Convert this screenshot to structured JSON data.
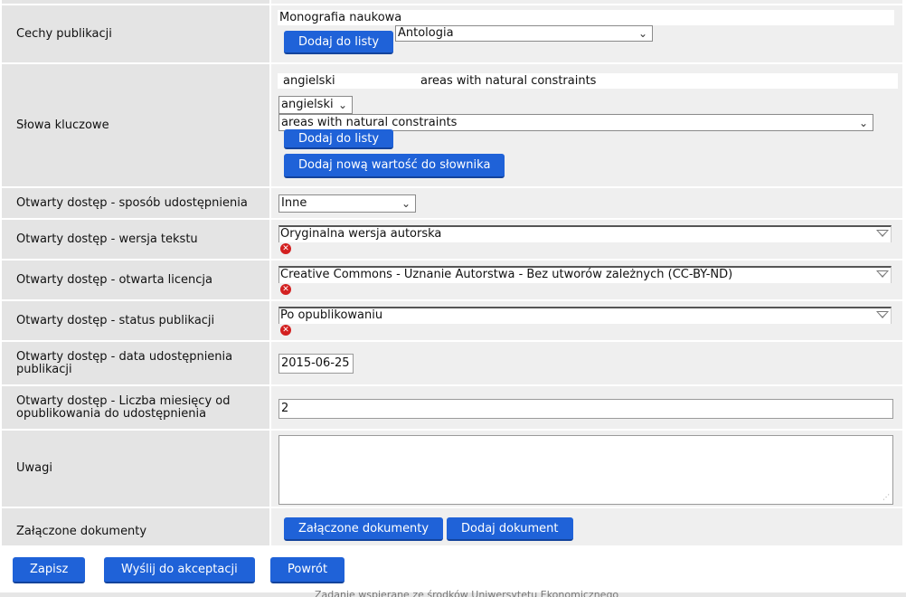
{
  "rows": {
    "cechy": {
      "label": "Cechy publikacji",
      "value": "Monografia naukowa",
      "select_value": "Antologia",
      "button": "Dodaj do listy"
    },
    "slowa": {
      "label": "Słowa kluczowe",
      "entry_lang": "angielski",
      "entry_text": "areas with natural constraints",
      "lang_select": "angielski",
      "keyword_select": "areas with natural constraints",
      "button_add": "Dodaj do listy",
      "button_new": "Dodaj nową wartość do słownika"
    },
    "sposob": {
      "label": "Otwarty dostęp - sposób udostępnienia",
      "select_value": "Inne"
    },
    "wersja": {
      "label": "Otwarty dostęp - wersja tekstu",
      "value": "Oryginalna wersja autorska"
    },
    "licencja": {
      "label": "Otwarty dostęp - otwarta licencja",
      "value": "Creative Commons - Uznanie Autorstwa - Bez utworów zależnych (CC-BY-ND)"
    },
    "status": {
      "label": "Otwarty dostęp - status publikacji",
      "value": "Po opublikowaniu"
    },
    "data": {
      "label": "Otwarty dostęp - data udostępnienia publikacji",
      "value": "2015-06-25"
    },
    "miesiace": {
      "label": "Otwarty dostęp - Liczba miesięcy od opublikowania do udostępnienia",
      "value": "2"
    },
    "uwagi": {
      "label": "Uwagi",
      "value": ""
    },
    "dokumenty": {
      "label": "Załączone dokumenty",
      "button_docs": "Załączone dokumenty",
      "button_add": "Dodaj dokument"
    }
  },
  "actions": {
    "save": "Zapisz",
    "send": "Wyślij do akceptacji",
    "back": "Powrót"
  },
  "footer": {
    "text": "Zadanie wspierane ze środków Uniwersytetu Ekonomicznego"
  },
  "colors": {
    "button": "#1f62d8",
    "label_bg": "#e4e4e4",
    "value_bg": "#efefef",
    "error_icon": "#d32020"
  },
  "icons": {
    "chevron": "chevron-down-icon",
    "dropdown": "dropdown-triangle-icon",
    "remove": "remove-x-icon",
    "resize": "resize-handle-icon"
  }
}
